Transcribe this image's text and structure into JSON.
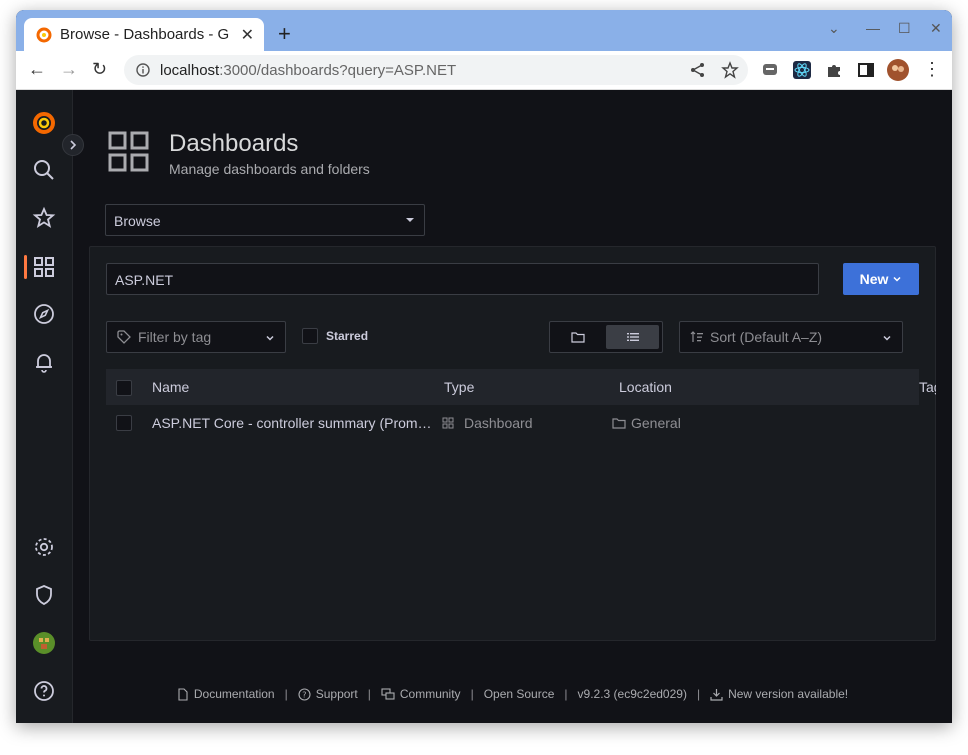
{
  "browser": {
    "tab_title": "Browse - Dashboards - Grafana",
    "url_host": "localhost",
    "url_rest": ":3000/dashboards?query=ASP.NET"
  },
  "page": {
    "title": "Dashboards",
    "subtitle": "Manage dashboards and folders"
  },
  "view_select": {
    "value": "Browse"
  },
  "search": {
    "value": "ASP.NET"
  },
  "new_button": {
    "label": "New"
  },
  "filters": {
    "tag_placeholder": "Filter by tag",
    "starred_label": "Starred",
    "sort_label": "Sort (Default A–Z)"
  },
  "table": {
    "headers": {
      "name": "Name",
      "type": "Type",
      "location": "Location",
      "tags": "Tags"
    },
    "rows": [
      {
        "name": "ASP.NET Core - controller summary (Prom…",
        "type": "Dashboard",
        "location": "General"
      }
    ]
  },
  "footer": {
    "documentation": "Documentation",
    "support": "Support",
    "community": "Community",
    "open_source": "Open Source",
    "version": "v9.2.3 (ec9c2ed029)",
    "new_version": "New version available!"
  },
  "colors": {
    "accent": "#3d71d9",
    "active_nav": "#ff7941",
    "background": "#111217"
  }
}
